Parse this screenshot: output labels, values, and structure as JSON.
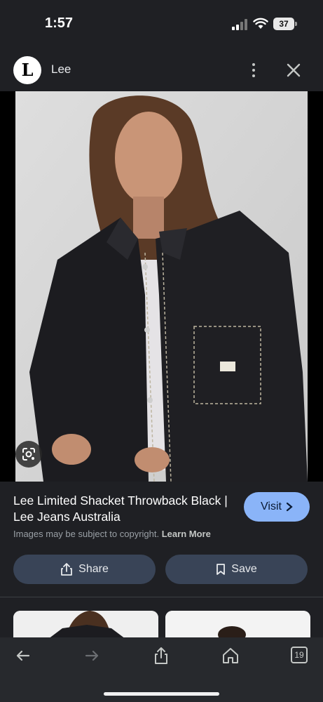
{
  "status_bar": {
    "time": "1:57",
    "battery": "37"
  },
  "header": {
    "site_name": "Lee",
    "logo_letter": "L",
    "icons": [
      "more-vert-icon",
      "close-icon"
    ]
  },
  "image": {
    "alt": "Woman wearing black denim shacket with contrast stitching over white tank top",
    "lens_icon": "google-lens-icon"
  },
  "result": {
    "title": "Lee Limited Shacket Throwback Black | Lee Jeans Australia",
    "visit_label": "Visit",
    "copyright_text": "Images may be subject to copyright.",
    "learn_more": "Learn More",
    "share_label": "Share",
    "save_label": "Save"
  },
  "toolbar": {
    "tabs_count": "19",
    "icons": [
      "back-arrow-icon",
      "forward-arrow-icon",
      "share-icon",
      "home-icon",
      "tabs-icon"
    ]
  },
  "colors": {
    "background": "#1f2024",
    "visit_button": "#8ab4f8",
    "action_button": "#394457"
  }
}
